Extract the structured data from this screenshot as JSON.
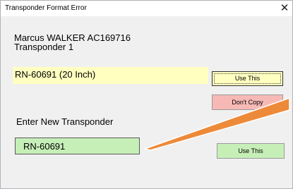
{
  "window": {
    "title": "Transponder Format Error",
    "close_glyph": "✕"
  },
  "info": {
    "name_line": "Marcus WALKER AC169716",
    "transponder_line": "Transponder 1"
  },
  "current": {
    "value": "RN-60691 (20 Inch)"
  },
  "buttons": {
    "use_this_top": "Use This",
    "dont_copy": "Don't Copy",
    "use_this_bottom": "Use This"
  },
  "new_transponder": {
    "label": "Enter New Transponder",
    "value": "RN-60691"
  },
  "colors": {
    "yellow_field": "#ffffc0",
    "green_field": "#c6efb8",
    "red_button": "#f7b9b5",
    "annotation_arrow": "#ed8a3a"
  }
}
